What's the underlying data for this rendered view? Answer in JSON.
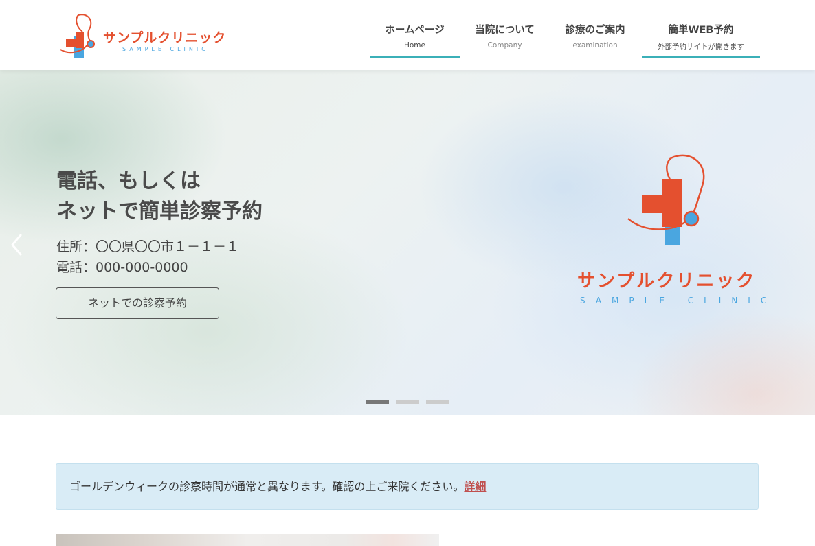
{
  "brand": {
    "name": "サンプルクリニック",
    "sub": "SAMPLE CLINIC",
    "primary_color": "#e4502f",
    "secondary_color": "#4aa6e0",
    "logo_icon": "medical-cross-stethoscope-icon"
  },
  "nav": {
    "items": [
      {
        "label": "ホームページ",
        "sub": "Home",
        "active": true
      },
      {
        "label": "当院について",
        "sub": "Company"
      },
      {
        "label": "診療のご案内",
        "sub": "examination"
      },
      {
        "label": "簡単WEB予約",
        "sub": "外部予約サイトが開きます"
      }
    ]
  },
  "hero": {
    "title_line1": "電話、もしくは",
    "title_line2": "ネットで簡単診察予約",
    "address": "住所：〇〇県〇〇市１－１－１",
    "phone": "電話：000-000-0000",
    "button_label": "ネットでの診察予約",
    "prev_icon": "chevron-left-icon",
    "slide_count": 3,
    "active_slide": 1
  },
  "notice": {
    "text": "ゴールデンウィークの診察時間が通常と異なります。確認の上ご来院ください。",
    "link_label": "詳細"
  }
}
